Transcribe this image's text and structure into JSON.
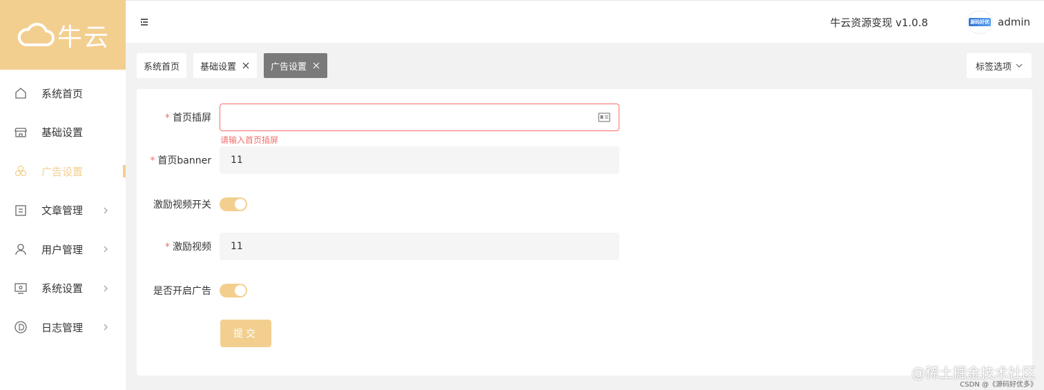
{
  "logo": {
    "text": "牛云"
  },
  "sidebar": {
    "items": [
      {
        "label": "系统首页",
        "icon": "home-icon",
        "expandable": false,
        "active": false
      },
      {
        "label": "基础设置",
        "icon": "store-icon",
        "expandable": false,
        "active": false
      },
      {
        "label": "广告设置",
        "icon": "circles-icon",
        "expandable": false,
        "active": true
      },
      {
        "label": "文章管理",
        "icon": "document-icon",
        "expandable": true,
        "active": false
      },
      {
        "label": "用户管理",
        "icon": "user-icon",
        "expandable": true,
        "active": false
      },
      {
        "label": "系统设置",
        "icon": "monitor-icon",
        "expandable": true,
        "active": false
      },
      {
        "label": "日志管理",
        "icon": "circle-d-icon",
        "expandable": true,
        "active": false
      }
    ]
  },
  "header": {
    "app_version": "牛云资源变现 v1.0.8",
    "avatar_text": "源码好优多",
    "username": "admin"
  },
  "tabs": [
    {
      "label": "系统首页",
      "closable": false,
      "active": false
    },
    {
      "label": "基础设置",
      "closable": true,
      "active": false
    },
    {
      "label": "广告设置",
      "closable": true,
      "active": true
    }
  ],
  "tab_options_label": "标签选项",
  "form": {
    "fields": [
      {
        "label": "首页插屏",
        "required": true,
        "type": "input",
        "value": "",
        "error": "请输入首页插屏"
      },
      {
        "label": "首页banner",
        "required": true,
        "type": "input",
        "value": "11"
      },
      {
        "label": "激励视频开关",
        "required": false,
        "type": "switch",
        "on": true
      },
      {
        "label": "激励视频",
        "required": true,
        "type": "input",
        "value": "11"
      },
      {
        "label": "是否开启广告",
        "required": false,
        "type": "switch",
        "on": true
      }
    ],
    "submit_label": "提交"
  },
  "watermark": {
    "main": "@稀土掘金技术社区",
    "sub": "CSDN @《源码好优多》"
  },
  "colors": {
    "accent": "#f3cf8f",
    "error": "#f56c6c",
    "active_tab": "#7a7a7a"
  }
}
